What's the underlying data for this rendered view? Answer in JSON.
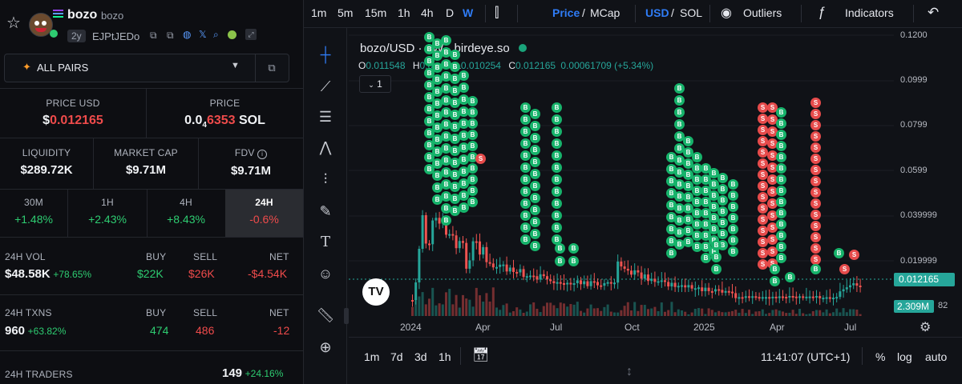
{
  "token": {
    "symbol": "bozo",
    "name": "bozo",
    "age": "2y",
    "address": "EJPtJEDo"
  },
  "pairs_selector": {
    "label": "ALL PAIRS"
  },
  "price": {
    "usd_label": "PRICE USD",
    "usd_prefix": "$",
    "usd_value": "0.012165",
    "native_label": "PRICE",
    "native_prefix": "0.0",
    "native_sub": "4",
    "native_digits": "6353",
    "native_unit": "SOL"
  },
  "metrics": [
    {
      "label": "LIQUIDITY",
      "value": "$289.72K"
    },
    {
      "label": "MARKET CAP",
      "value": "$9.71M"
    },
    {
      "label": "FDV",
      "value": "$9.71M"
    }
  ],
  "timeframes": [
    {
      "label": "30M",
      "value": "+1.48%",
      "color": "#2ecc71"
    },
    {
      "label": "1H",
      "value": "+2.43%",
      "color": "#2ecc71"
    },
    {
      "label": "4H",
      "value": "+8.43%",
      "color": "#2ecc71"
    },
    {
      "label": "24H",
      "value": "-0.6%",
      "color": "#ef4b4b"
    }
  ],
  "vol": {
    "label": "24H VOL",
    "value": "$48.58K",
    "change": "+78.65%",
    "buy_label": "BUY",
    "buy": "$22K",
    "sell_label": "SELL",
    "sell": "$26K",
    "net_label": "NET",
    "net": "-$4.54K"
  },
  "txns": {
    "label": "24H TXNS",
    "value": "960",
    "change": "+63.82%",
    "buy_label": "BUY",
    "buy": "474",
    "sell_label": "SELL",
    "sell": "486",
    "net_label": "NET",
    "net": "-12"
  },
  "traders": {
    "label": "24H TRADERS",
    "value": "149",
    "change": "+24.16%"
  },
  "toolbar": {
    "intervals": [
      "1m",
      "5m",
      "15m",
      "1h",
      "4h",
      "D",
      "W"
    ],
    "active_interval": "W",
    "price_label": "Price",
    "mcap_label": "MCap",
    "usd_label": "USD",
    "sol_label": "SOL",
    "outliers_label": "Outliers",
    "indicators_label": "Indicators"
  },
  "legend": {
    "title": "bozo/USD · 1W · birdeye.so",
    "o_label": "O",
    "o": "0.011548",
    "h_label": "H",
    "h": "0.0…2",
    "l_label": "L",
    "l": "0.010254",
    "c_label": "C",
    "c": "0.012165",
    "change": "0.00061709 (+5.34%)",
    "indicator_count": "1"
  },
  "price_tag": "0.012165",
  "volume_tag": "2.309M",
  "volume_tag_tail": "82",
  "bottom": {
    "ranges": [
      "1m",
      "7d",
      "3d",
      "1h"
    ],
    "clock": "11:41:07 (UTC+1)",
    "pct": "%",
    "log": "log",
    "auto": "auto"
  },
  "chart_data": {
    "type": "candlestick",
    "y_ticks": [
      "0.1200",
      "0.0999",
      "0.0799",
      "0.0599",
      "0.039999",
      "0.019999"
    ],
    "x_ticks": [
      "2024",
      "Apr",
      "Jul",
      "Oct",
      "2025",
      "Apr",
      "Jul"
    ],
    "last_price": 0.012165,
    "colors": {
      "up": "#26a69a",
      "down": "#ef5350",
      "buy": "#17b36b",
      "sell": "#e64b4b"
    }
  }
}
